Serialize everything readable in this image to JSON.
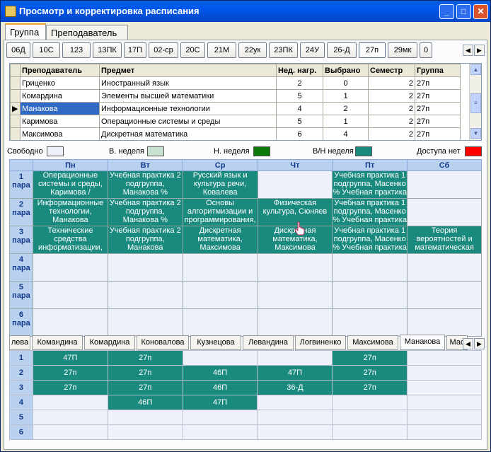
{
  "window": {
    "title": "Просмотр и корректировка расписания",
    "min": "_",
    "max": "□",
    "close": "✕"
  },
  "tabs": [
    "Группа",
    "Преподаватель"
  ],
  "groups": [
    "06Д",
    "10С",
    "123",
    "13ПК",
    "17П",
    "02-ср",
    "20С",
    "21М",
    "22ук",
    "23ПК",
    "24У",
    "26-Д",
    "27п",
    "29мк",
    "0"
  ],
  "group_nav": {
    "left": "◀",
    "right": "▶"
  },
  "teacher_table": {
    "headers": [
      "Преподаватель",
      "Предмет",
      "Нед. нагр.",
      "Выбрано",
      "Семестр",
      "Группа"
    ],
    "rows": [
      [
        "Гриценко",
        "Иностранный язык",
        "2",
        "0",
        "2",
        "27п"
      ],
      [
        "Комардина",
        "Элементы высшей математики",
        "5",
        "1",
        "2",
        "27п"
      ],
      [
        "Манакова",
        "Информационные технологии",
        "4",
        "2",
        "2",
        "27п"
      ],
      [
        "Каримова",
        "Операционные системы и среды",
        "5",
        "1",
        "2",
        "27п"
      ],
      [
        "Максимова",
        "Дискретная математика",
        "6",
        "4",
        "2",
        "27п"
      ]
    ],
    "row_indicator": "▶",
    "scroll_up": "▲",
    "scroll_down": "▼"
  },
  "legend": {
    "free": "Свободно",
    "week_upper": "В. неделя",
    "week_lower": "Н. неделя",
    "week_both": "В/Н неделя",
    "no_access": "Доступа нет",
    "colors": {
      "free": "#eef1f9",
      "upper": "#c7e0cf",
      "lower": "#0b7a0b",
      "both": "#1b8a7e",
      "noaccess": "#ff0000"
    }
  },
  "schedule": {
    "days": [
      "Пн",
      "Вт",
      "Ср",
      "Чт",
      "Пт",
      "Сб"
    ],
    "periods": [
      {
        "label": "1 пара",
        "cells": [
          "Операционные системы и среды, Каримова /",
          "Учебная практика 2 подгруппа, Манакова %",
          "Русский язык и культура речи, Ковалева",
          "",
          "Учебная практика 1 подгруппа, Масенко % Учебная практика",
          ""
        ]
      },
      {
        "label": "2 пара",
        "cells": [
          "Информационные технологии, Манакова",
          "Учебная практика 2 подгруппа, Манакова %",
          "Основы алгоритмизации и программирования,",
          "Физическая культура, Сюняев",
          "Учебная практика 1 подгруппа, Масенко % Учебная практика",
          ""
        ]
      },
      {
        "label": "3 пара",
        "cells": [
          "Технические средства информатизации,",
          "Учебная практика 2 подгруппа, Манакова",
          "Дискретная математика, Максимова",
          "Дискретная математика, Максимова",
          "Учебная практика 1 подгруппа, Масенко % Учебная практика",
          "Теория вероятностей и математическая"
        ]
      },
      {
        "label": "4 пара",
        "cells": [
          "",
          "",
          "",
          "",
          "",
          ""
        ]
      },
      {
        "label": "5 пара",
        "cells": [
          "",
          "",
          "",
          "",
          "",
          ""
        ]
      },
      {
        "label": "6 пара",
        "cells": [
          "",
          "",
          "",
          "",
          "",
          ""
        ]
      }
    ]
  },
  "teacher_tabs": [
    "лева",
    "Командина",
    "Комардина",
    "Коновалова",
    "Кузнецова",
    "Левандина",
    "Логвиненко",
    "Максимова",
    "Манакова",
    "Мас"
  ],
  "teacher_nav": {
    "left": "◀",
    "right": "▶"
  },
  "teacher_schedule": {
    "rows": [
      {
        "label": "1",
        "cells": [
          "47П",
          "27п",
          "",
          "",
          "27п",
          ""
        ]
      },
      {
        "label": "2",
        "cells": [
          "27п",
          "27п",
          "46П",
          "47П",
          "27п",
          ""
        ]
      },
      {
        "label": "3",
        "cells": [
          "27п",
          "27п",
          "46П",
          "36-Д",
          "27п",
          ""
        ]
      },
      {
        "label": "4",
        "cells": [
          "",
          "46П",
          "47П",
          "",
          "",
          ""
        ]
      },
      {
        "label": "5",
        "cells": [
          "",
          "",
          "",
          "",
          "",
          ""
        ]
      },
      {
        "label": "6",
        "cells": [
          "",
          "",
          "",
          "",
          "",
          ""
        ]
      }
    ]
  }
}
